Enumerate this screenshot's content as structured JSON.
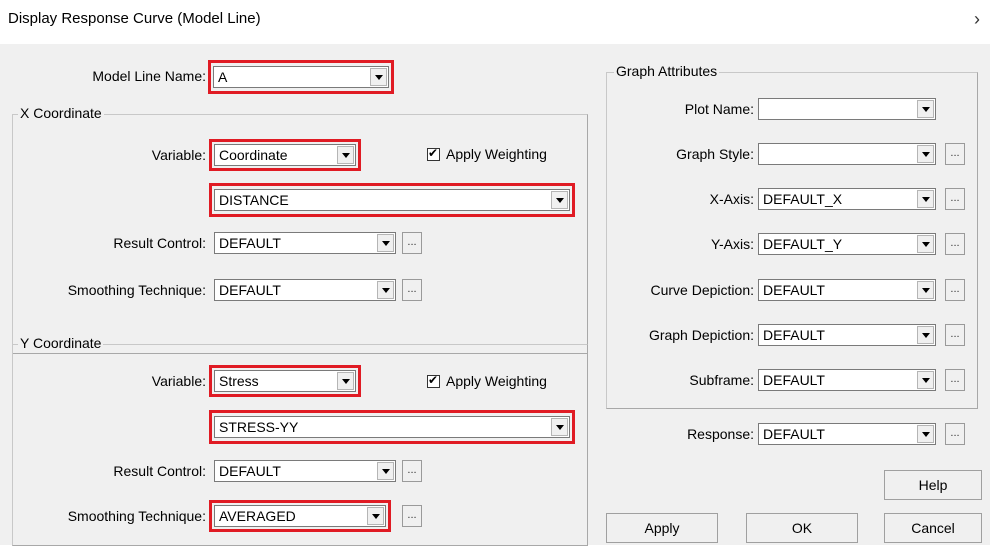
{
  "window": {
    "title": "Display Response Curve (Model Line)"
  },
  "model_line": {
    "label": "Model Line Name:",
    "value": "A"
  },
  "x_coord": {
    "group_label": "X Coordinate",
    "variable_label": "Variable:",
    "variable_value": "Coordinate",
    "apply_weighting_label": "Apply Weighting",
    "component_value": "DISTANCE",
    "result_control_label": "Result Control:",
    "result_control_value": "DEFAULT",
    "smoothing_label": "Smoothing Technique:",
    "smoothing_value": "DEFAULT",
    "ellipsis": "..."
  },
  "y_coord": {
    "group_label": "Y Coordinate",
    "variable_label": "Variable:",
    "variable_value": "Stress",
    "apply_weighting_label": "Apply Weighting",
    "component_value": "STRESS-YY",
    "result_control_label": "Result Control:",
    "result_control_value": "DEFAULT",
    "smoothing_label": "Smoothing Technique:",
    "smoothing_value": "AVERAGED",
    "ellipsis": "..."
  },
  "graph": {
    "group_label": "Graph Attributes",
    "plot_name_label": "Plot Name:",
    "plot_name_value": "",
    "graph_style_label": "Graph Style:",
    "graph_style_value": "",
    "x_axis_label": "X-Axis:",
    "x_axis_value": "DEFAULT_X",
    "y_axis_label": "Y-Axis:",
    "y_axis_value": "DEFAULT_Y",
    "curve_depiction_label": "Curve Depiction:",
    "curve_depiction_value": "DEFAULT",
    "graph_depiction_label": "Graph Depiction:",
    "graph_depiction_value": "DEFAULT",
    "subframe_label": "Subframe:",
    "subframe_value": "DEFAULT",
    "ellipsis": "..."
  },
  "response": {
    "label": "Response:",
    "value": "DEFAULT",
    "ellipsis": "..."
  },
  "buttons": {
    "help": "Help",
    "apply": "Apply",
    "ok": "OK",
    "cancel": "Cancel"
  },
  "colors": {
    "highlight": "#e01b24",
    "dialog_bg": "#f0f0f0"
  }
}
